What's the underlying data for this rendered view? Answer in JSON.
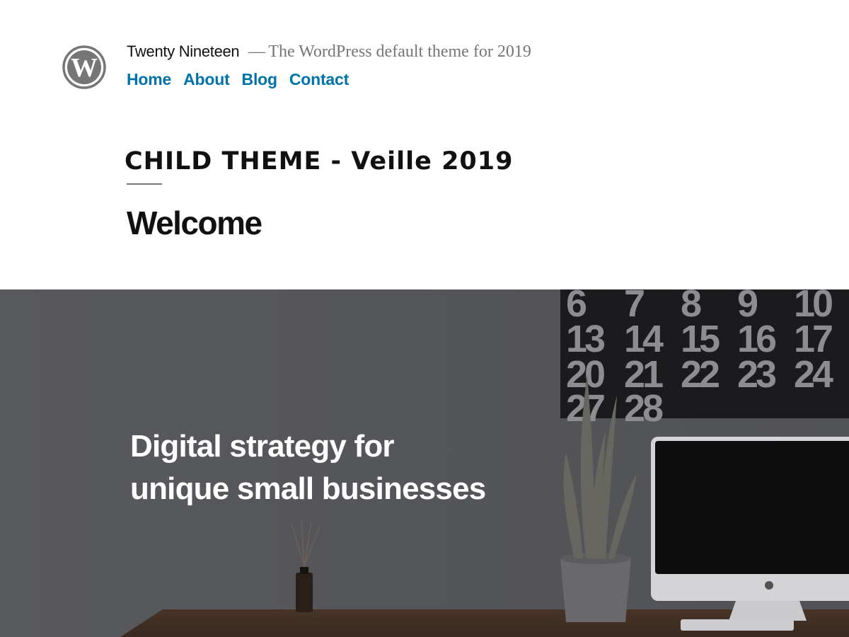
{
  "site": {
    "title": "Twenty Nineteen",
    "separator": "—",
    "description": "The WordPress default theme for 2019",
    "logo_icon": "wordpress-logo-icon"
  },
  "nav": [
    {
      "label": "Home"
    },
    {
      "label": "About"
    },
    {
      "label": "Blog"
    },
    {
      "label": "Contact"
    }
  ],
  "child_theme_label": "CHILD THEME - Veille 2019",
  "page_title": "Welcome",
  "hero": {
    "line1": "Digital strategy for",
    "line2": "unique small businesses",
    "calendar_numbers": [
      "6",
      "7",
      "8",
      "9",
      "10",
      "13",
      "14",
      "15",
      "16",
      "17",
      "20",
      "21",
      "22",
      "23",
      "24",
      "27",
      "28"
    ]
  },
  "colors": {
    "link": "#0073aa",
    "text": "#111111",
    "muted": "#767676",
    "hero_bg": "#56575b"
  }
}
